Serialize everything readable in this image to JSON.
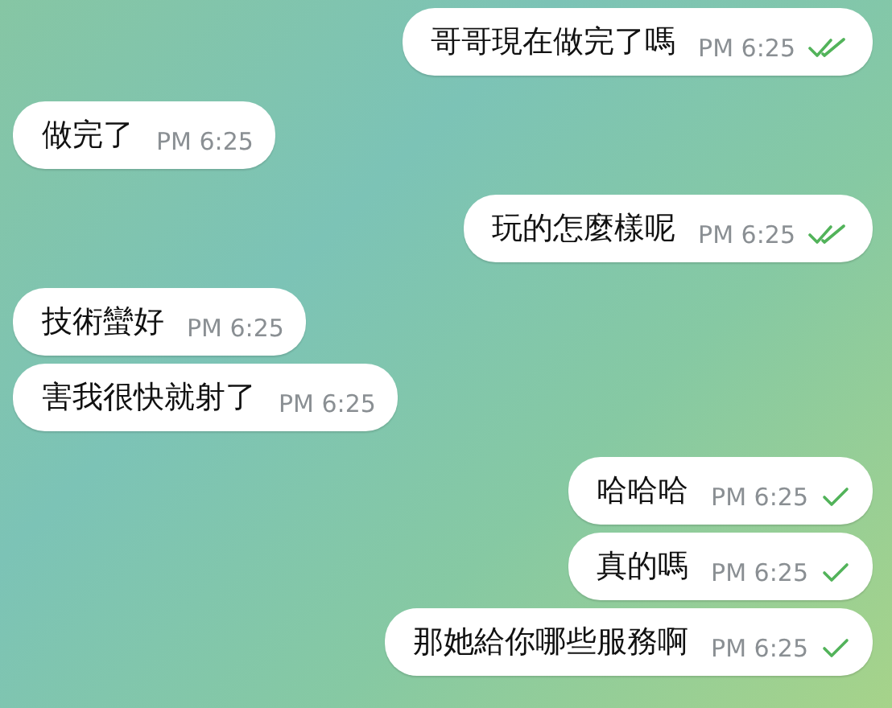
{
  "messages": [
    {
      "outgoing": true,
      "text": "哥哥現在做完了嗎",
      "time": "PM 6:25",
      "read": true
    },
    {
      "outgoing": false,
      "text": "做完了",
      "time": "PM 6:25"
    },
    {
      "outgoing": true,
      "text": "玩的怎麼樣呢",
      "time": "PM 6:25",
      "read": true
    },
    {
      "outgoing": false,
      "text": "技術蠻好",
      "time": "PM 6:25"
    },
    {
      "outgoing": false,
      "text": "害我很快就射了",
      "time": "PM 6:25"
    },
    {
      "outgoing": true,
      "text": "哈哈哈",
      "time": "PM 6:25",
      "read": false
    },
    {
      "outgoing": true,
      "text": "真的嗎",
      "time": "PM 6:25",
      "read": false
    },
    {
      "outgoing": true,
      "text": "那她給你哪些服務啊",
      "time": "PM 6:25",
      "read": false
    }
  ]
}
